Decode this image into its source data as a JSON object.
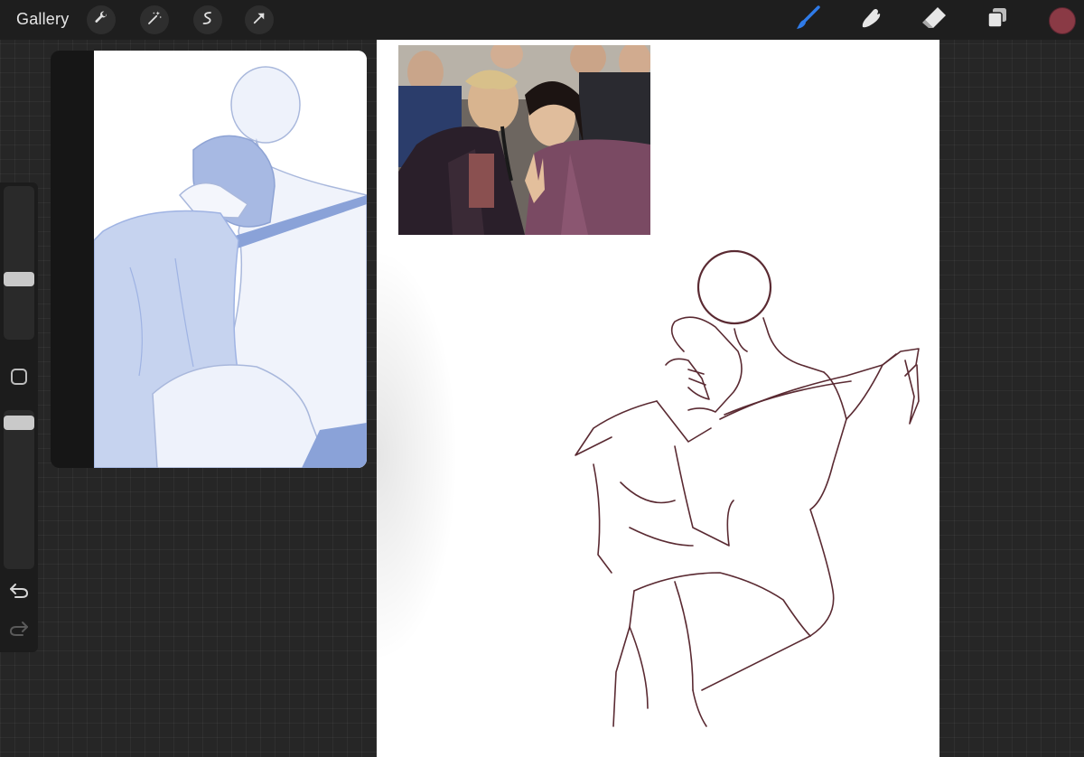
{
  "app": {
    "gallery_label": "Gallery"
  },
  "toolbar_left": [
    {
      "name": "actions-wrench-icon"
    },
    {
      "name": "adjustments-wand-icon"
    },
    {
      "name": "selection-s-icon"
    },
    {
      "name": "transform-arrow-icon"
    }
  ],
  "toolbar_right": [
    {
      "name": "brush-icon",
      "active": true,
      "color": "#2f7be8"
    },
    {
      "name": "smudge-icon"
    },
    {
      "name": "eraser-icon"
    },
    {
      "name": "layers-icon"
    }
  ],
  "current_color": "#8a3a45",
  "sidebar": {
    "brush_size_level": 0.45,
    "brush_opacity_level": 0.05
  },
  "canvas": {
    "background": "#ffffff",
    "sketch_stroke_color": "#5a2a32"
  },
  "reference": {
    "tint": "#9fb3e3"
  }
}
